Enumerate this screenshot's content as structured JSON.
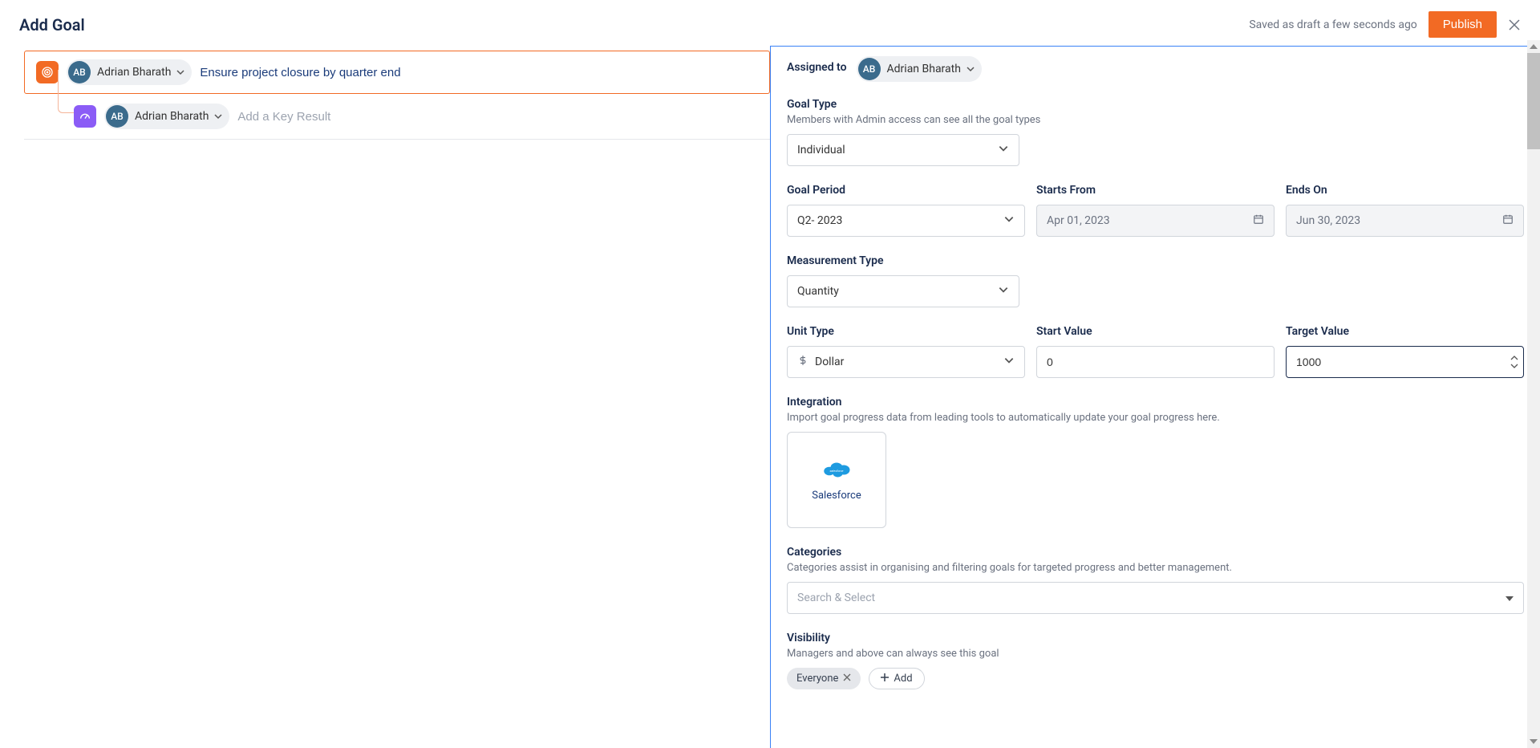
{
  "header": {
    "title": "Add Goal",
    "saved_text": "Saved as draft a few seconds ago",
    "publish_label": "Publish"
  },
  "goal": {
    "owner_initials": "AB",
    "owner_name": "Adrian Bharath",
    "goal_text": "Ensure project closure by quarter end"
  },
  "key_result": {
    "owner_initials": "AB",
    "owner_name": "Adrian Bharath",
    "placeholder": "Add a Key Result"
  },
  "assigned": {
    "label": "Assigned to",
    "owner_initials": "AB",
    "owner_name": "Adrian Bharath"
  },
  "goal_type": {
    "label": "Goal Type",
    "desc": "Members with Admin access can see all the goal types",
    "value": "Individual"
  },
  "goal_period": {
    "label": "Goal Period",
    "value": "Q2- 2023"
  },
  "starts_from": {
    "label": "Starts From",
    "value": "Apr 01, 2023"
  },
  "ends_on": {
    "label": "Ends On",
    "value": "Jun 30, 2023"
  },
  "measurement": {
    "label": "Measurement Type",
    "value": "Quantity"
  },
  "unit_type": {
    "label": "Unit Type",
    "value": "Dollar"
  },
  "start_value": {
    "label": "Start Value",
    "value": "0"
  },
  "target_value": {
    "label": "Target Value",
    "value": "1000"
  },
  "integration": {
    "label": "Integration",
    "desc": "Import goal progress data from leading tools to automatically update your goal progress here.",
    "option": "Salesforce"
  },
  "categories": {
    "label": "Categories",
    "desc": "Categories assist in organising and filtering goals for targeted progress and better management.",
    "placeholder": "Search & Select"
  },
  "visibility": {
    "label": "Visibility",
    "desc": "Managers and above can always see this goal",
    "pill": "Everyone",
    "add_label": "Add"
  }
}
